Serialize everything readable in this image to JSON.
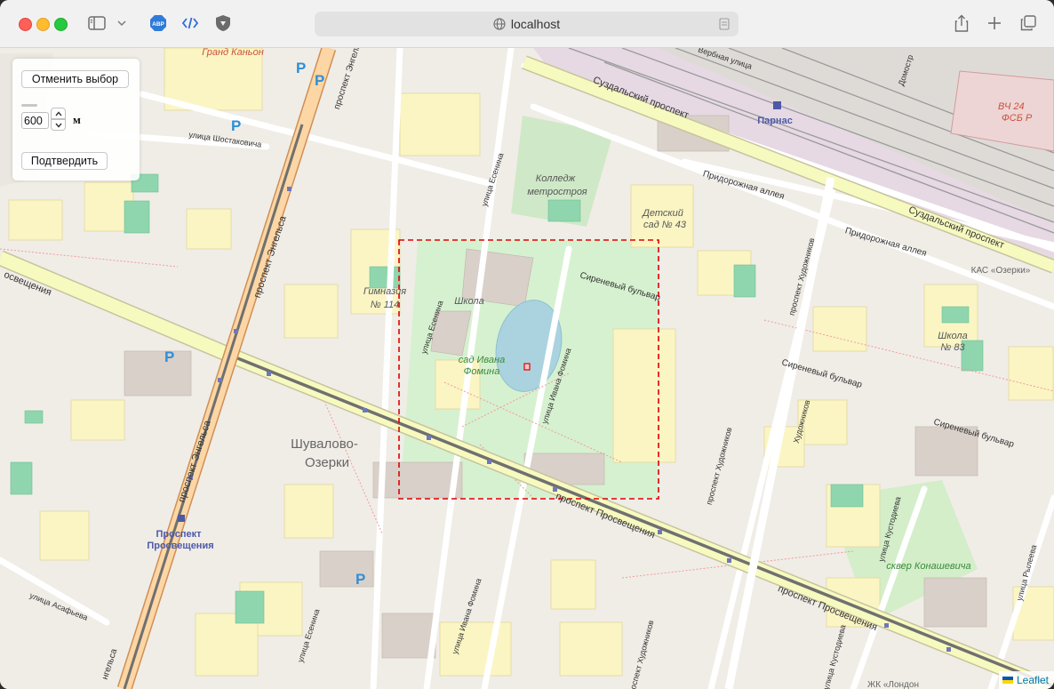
{
  "browser": {
    "url": "localhost",
    "icons": [
      "sidebar-icon",
      "chevron-down-icon",
      "adblock-extension-icon",
      "code-extension-icon",
      "shield-icon",
      "share-icon",
      "new-tab-icon",
      "tabs-overview-icon",
      "globe-icon",
      "reader-icon"
    ],
    "adblock_label": "ABP"
  },
  "controls": {
    "cancel_label": "Отменить выбор",
    "radius_value": "600",
    "unit_label": "м",
    "confirm_label": "Подтвердить"
  },
  "map": {
    "attribution": "Leaflet",
    "selection_color": "#e00000",
    "labels": {
      "grand_canyon": "Гранд Каньон",
      "parnas": "Парнас",
      "suzdalsky_1": "Суздальский проспект",
      "suzdalsky_2": "Суздальский проспект",
      "prigorodnaya_1": "Придорожная аллея",
      "prigorodnaya_2": "Придорожная аллея",
      "vch": "ВЧ 24",
      "fsb": "ФСБ Р",
      "college_1": "Колледж",
      "college_2": "метростроя",
      "kindergarten_1": "Детский",
      "kindergarten_2": "сад № 43",
      "gymnasium_1": "Гимназия",
      "gymnasium_2": "№ 114",
      "school": "Школа",
      "garden_1": "сад Ивана",
      "garden_2": "Фомина",
      "sirenevy_1": "Сиреневый бульвар",
      "sirenevy_2": "Сиреневый бульвар",
      "sirenevy_3": "Сиреневый бульвар",
      "school83_1": "Школа",
      "school83_2": "№ 83",
      "kas": "КАС «Озерки»",
      "shuvalovo_1": "Шувалово-",
      "shuvalovo_2": "Озерки",
      "prosveshcheniya_st_1": "Проспект",
      "prosveshcheniya_st_2": "Просвещения",
      "pr_prosveshcheniya_1": "проспект Просвещения",
      "pr_prosveshcheniya_2": "проспект Просвещения",
      "pr_prosveshcheniya_3": "освещения",
      "engelsa_1": "проспект Энгельса",
      "engelsa_2": "проспект Энгельса",
      "engelsa_3": "проспект Энгельса",
      "engelsa_4": "нгельса",
      "shostakovicha": "улица Шостаковича",
      "esenina_1": "улица Есенина",
      "esenina_2": "улица Есенина",
      "esenina_3": "улица Есенина",
      "fomina_1": "улица Ивана Фомина",
      "fomina_2": "улица Ивана Фомина",
      "khudozhnikov_1": "проспект Художников",
      "khudozhnikov_2": "проспект Художников",
      "khudozhnikov_3": "проспект Художников",
      "khudozhnikov_4": "Художников",
      "kustodieva_1": "улица Кустодиева",
      "kustodieva_2": "улица Кустодиева",
      "ryleeva": "улица Рылеева",
      "asafyeva": "улица Асафьева",
      "konashevicha": "сквер Конашевича",
      "london": "ЖК «Лондон",
      "vyborgskoe": "Вербная улица",
      "domostroit": "Домостр",
      "parking": "P"
    }
  }
}
